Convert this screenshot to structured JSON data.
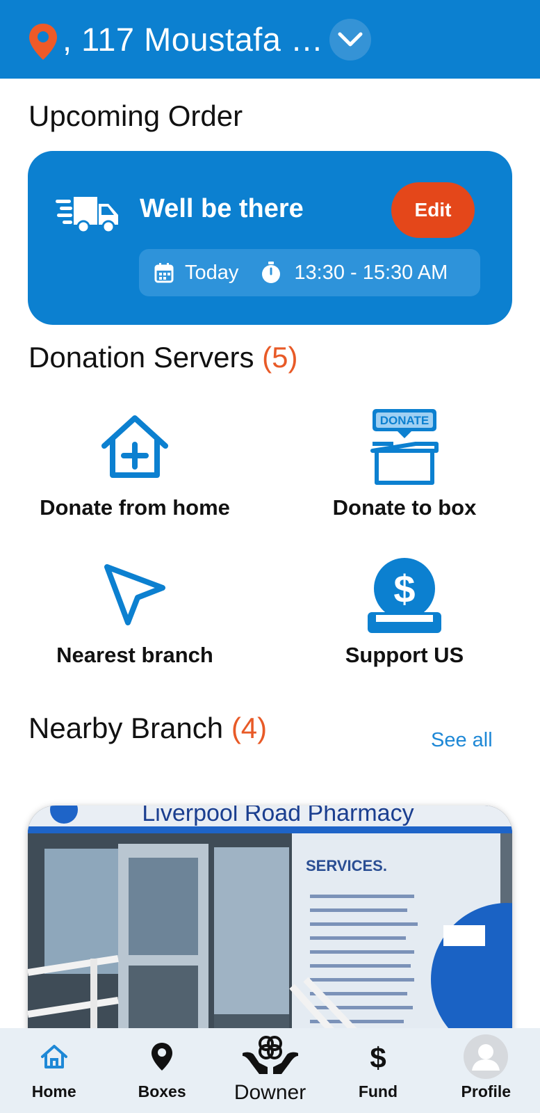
{
  "header": {
    "address": ", 117 Moustafa …",
    "location_icon": "map-pin-icon",
    "dropdown_icon": "chevron-down-icon"
  },
  "upcoming": {
    "section_title": "Upcoming Order",
    "card_title": "Well be there",
    "edit_label": "Edit",
    "day": "Today",
    "time_range": "13:30 - 15:30 AM"
  },
  "donation": {
    "section_title": "Donation Servers",
    "count": "(5)",
    "items": [
      {
        "label": "Donate from home",
        "icon": "house-plus-icon"
      },
      {
        "label": "Donate to box",
        "icon": "donate-box-icon",
        "badge": "DONATE"
      },
      {
        "label": "Nearest branch",
        "icon": "navigation-arrow-icon"
      },
      {
        "label": "Support US",
        "icon": "dollar-coin-icon"
      }
    ]
  },
  "nearby": {
    "section_title": "Nearby Branch",
    "count": "(4)",
    "see_all": "See all",
    "photo": {
      "sign": "Liverpool Road Pharmacy",
      "services_heading": "SERVICES."
    }
  },
  "nav": {
    "items": [
      {
        "label": "Home",
        "icon": "home-icon",
        "active": true
      },
      {
        "label": "Boxes",
        "icon": "location-pin-icon"
      },
      {
        "label": "Downer",
        "icon": "hands-heart-icon"
      },
      {
        "label": "Fund",
        "icon": "dollar-sign-icon"
      },
      {
        "label": "Profile",
        "icon": "avatar-icon"
      }
    ]
  },
  "colors": {
    "primary": "#0C80D0",
    "accent": "#E4471A",
    "count": "#E85A27",
    "nav_bg": "#E8EFF5"
  }
}
